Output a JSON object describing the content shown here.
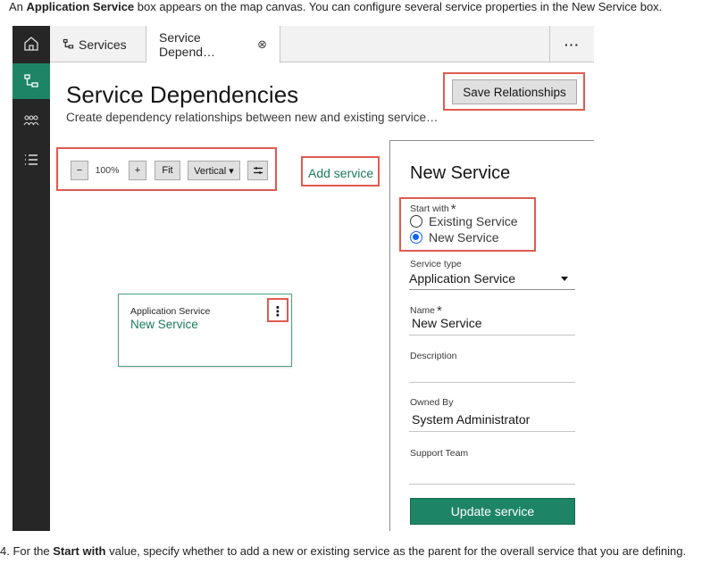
{
  "caption": {
    "prefix": "An ",
    "bold": "Application Service",
    "suffix": " box appears on the map canvas. You can configure several service properties in the New Service box."
  },
  "footer": {
    "prefix": "4. For the ",
    "bold": "Start with",
    "suffix": " value, specify whether to add a new or existing service as the parent for the overall service that you are defining."
  },
  "rail": {
    "items": [
      {
        "icon": "home-icon",
        "active": false
      },
      {
        "icon": "service-map-icon",
        "active": true
      },
      {
        "icon": "people-icon",
        "active": false
      },
      {
        "icon": "list-icon",
        "active": false
      }
    ]
  },
  "tabs": [
    {
      "label": "Services",
      "icon": "service-map-icon"
    },
    {
      "label": "Service Depend…",
      "close": "⊗"
    }
  ],
  "tab_overflow": "···",
  "page": {
    "title": "Service Dependencies",
    "subtitle": "Create dependency relationships between new and existing service…",
    "save_label": "Save Relationships"
  },
  "toolbar": {
    "zoom_out": "−",
    "zoom_level": "100%",
    "zoom_in": "+",
    "fit": "Fit",
    "layout": "Vertical ▾",
    "add_service": "Add service"
  },
  "node": {
    "type": "Application Service",
    "name": "New Service",
    "menu": "⋮"
  },
  "panel": {
    "title": "New Service",
    "start_with_label": "Start with",
    "required_mark": "*",
    "start_with_options": [
      "Existing Service",
      "New Service"
    ],
    "start_with_selected": "New Service",
    "service_type_label": "Service type",
    "service_type_value": "Application Service",
    "name_label": "Name",
    "name_value": "New Service",
    "description_label": "Description",
    "description_value": "",
    "owned_by_label": "Owned By",
    "owned_by_value": "System Administrator",
    "support_team_label": "Support Team",
    "support_team_value": "",
    "update_label": "Update service"
  },
  "colors": {
    "accent": "#1d8566",
    "highlight": "#e05a4f",
    "rail": "#262626",
    "link": "#1d7a60",
    "radio_selected": "#0f62fe"
  }
}
